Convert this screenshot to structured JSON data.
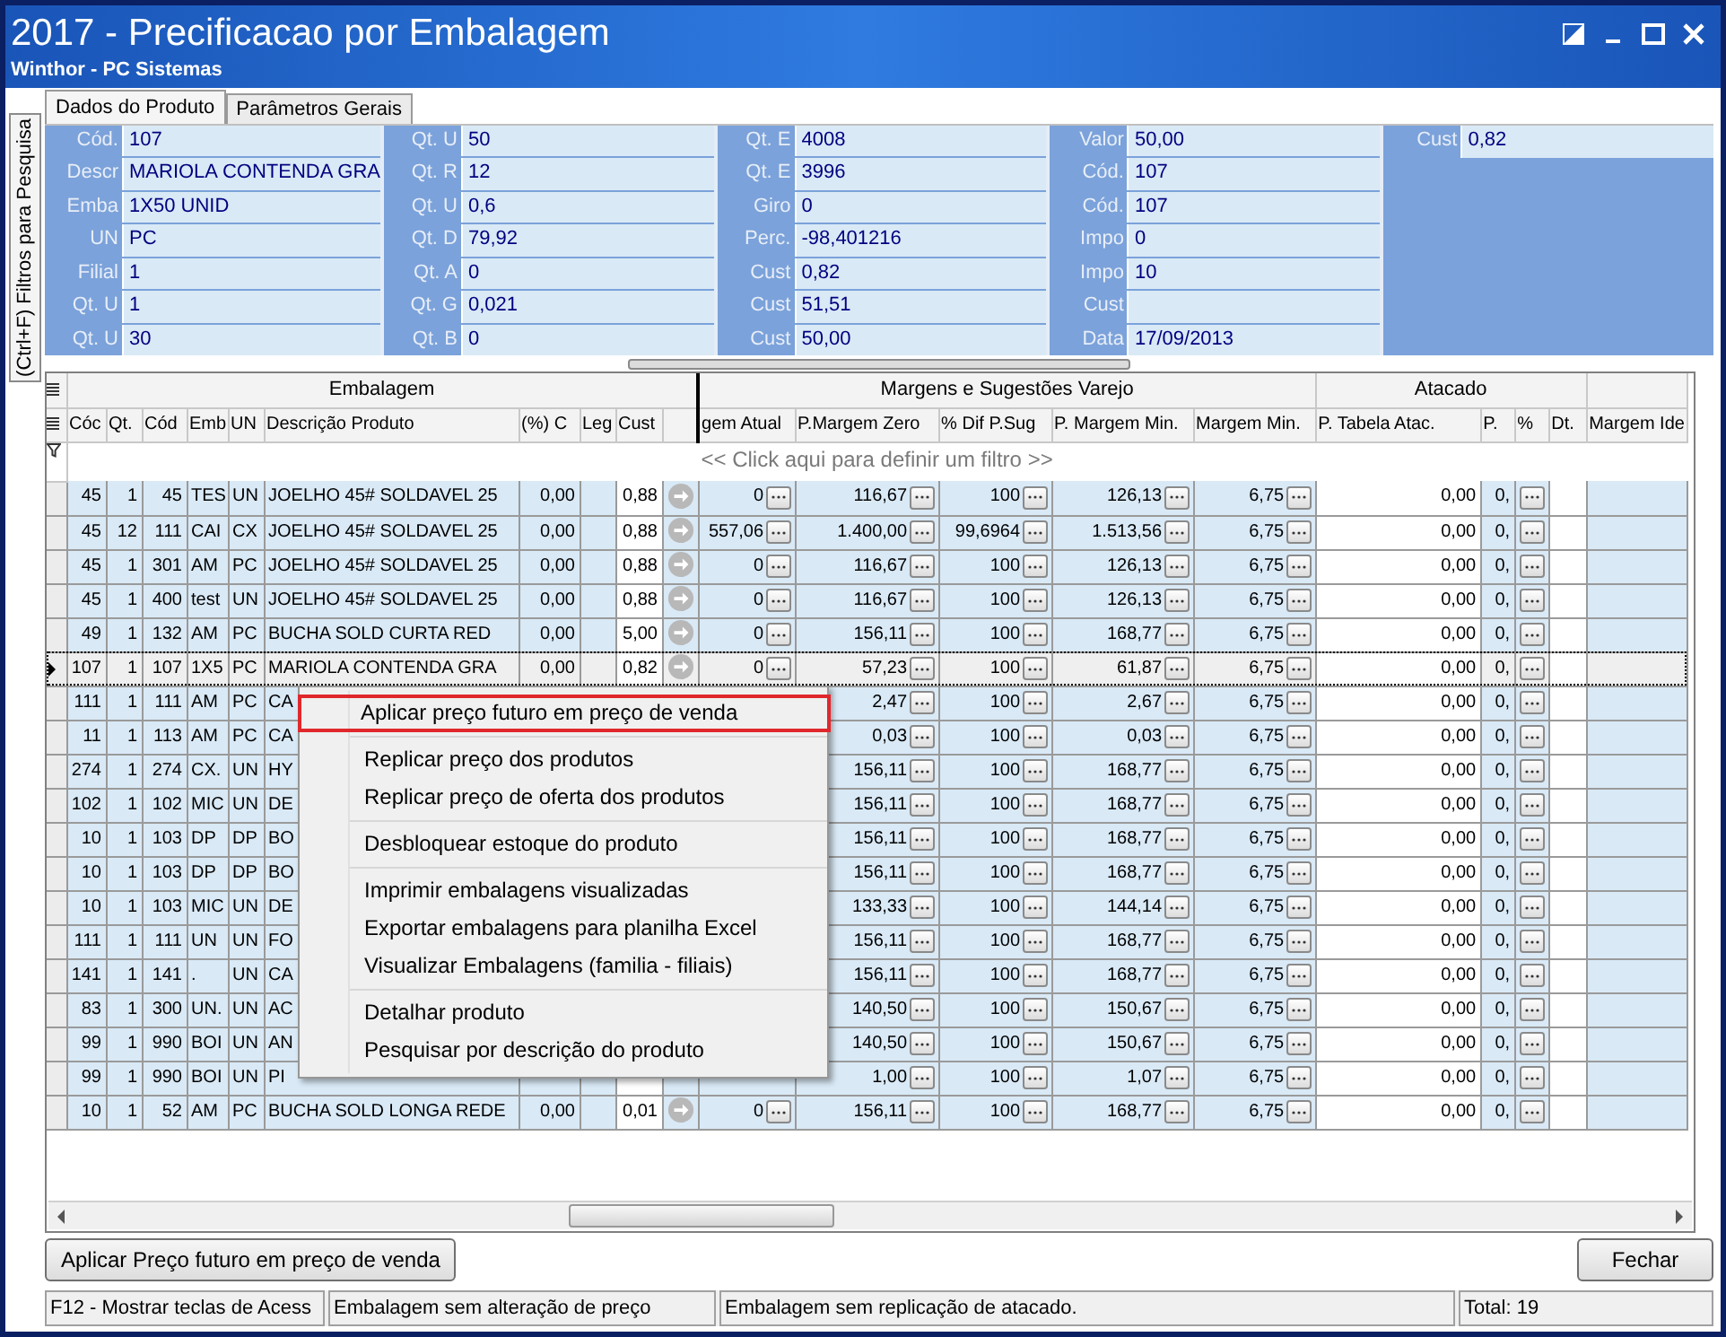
{
  "window": {
    "title": "2017 - Precificacao por Embalagem",
    "subtitle": "Winthor - PC Sistemas"
  },
  "side_tab": "(Ctrl+F) Filtros para Pesquisa",
  "tabs": [
    {
      "label": "Dados do Produto",
      "selected": true
    },
    {
      "label": "Parâmetros Gerais",
      "selected": false
    }
  ],
  "product_fields": [
    [
      {
        "label": "Cód.",
        "value": "107"
      },
      {
        "label": "Descr",
        "value": "MARIOLA CONTENDA GRA"
      },
      {
        "label": "Emba",
        "value": "1X50 UNID"
      },
      {
        "label": "UN",
        "value": "PC"
      },
      {
        "label": "Filial",
        "value": "1"
      },
      {
        "label": "Qt. U",
        "value": "1"
      },
      {
        "label": "Qt. U",
        "value": "30"
      }
    ],
    [
      {
        "label": "Qt. U",
        "value": "50"
      },
      {
        "label": "Qt. R",
        "value": "12"
      },
      {
        "label": "Qt. U",
        "value": "0,6"
      },
      {
        "label": "Qt. D",
        "value": "79,92"
      },
      {
        "label": "Qt. A",
        "value": "0"
      },
      {
        "label": "Qt. G",
        "value": "0,021"
      },
      {
        "label": "Qt. B",
        "value": "0"
      }
    ],
    [
      {
        "label": "Qt. E",
        "value": "4008"
      },
      {
        "label": "Qt. E",
        "value": "3996"
      },
      {
        "label": "Giro",
        "value": "0"
      },
      {
        "label": "Perc.",
        "value": "-98,401216"
      },
      {
        "label": "Cust",
        "value": "0,82"
      },
      {
        "label": "Cust",
        "value": "51,51"
      },
      {
        "label": "Cust",
        "value": "50,00"
      }
    ],
    [
      {
        "label": "Valor",
        "value": "50,00"
      },
      {
        "label": "Cód.",
        "value": "107"
      },
      {
        "label": "Cód.",
        "value": "107"
      },
      {
        "label": "Impo",
        "value": "0"
      },
      {
        "label": "Impo",
        "value": "10"
      },
      {
        "label": "Cust"
      },
      {
        "label": "Data",
        "value": "17/09/2013"
      }
    ],
    [
      {
        "label": "Cust",
        "value": "0,82"
      }
    ]
  ],
  "grid": {
    "groups": [
      {
        "label": "Embalagem",
        "columns": [
          {
            "label": "Cóc",
            "kind": "number"
          },
          {
            "label": "Qt.",
            "kind": "number"
          },
          {
            "label": "Cód",
            "kind": "number"
          },
          {
            "label": "Emb",
            "kind": "text"
          },
          {
            "label": "UN",
            "kind": "text"
          },
          {
            "label": "Descrição Produto",
            "kind": "text"
          },
          {
            "label": "(%) C",
            "kind": "number"
          },
          {
            "label": "Leg",
            "kind": "text"
          },
          {
            "label": "Cust",
            "kind": "editable"
          },
          {
            "kind": "action"
          }
        ]
      },
      {
        "label": "Margens e Sugestões Varejo",
        "columns": [
          {
            "label": "gem Atual",
            "kind": "picker"
          },
          {
            "label": "P.Margem Zero",
            "kind": "picker"
          },
          {
            "label": "% Dif P.Sug",
            "kind": "picker"
          },
          {
            "label": "P. Margem Min.",
            "kind": "picker"
          },
          {
            "label": "Margem Min.",
            "kind": "picker"
          }
        ]
      },
      {
        "label": "Atacado",
        "columns": [
          {
            "label": "P. Tabela Atac.",
            "kind": "editable"
          },
          {
            "label": "P.",
            "kind": "number"
          },
          {
            "label": "%",
            "kind": "button"
          },
          {
            "label": "Dt.",
            "kind": "editable"
          }
        ]
      },
      {
        "columns": [
          {
            "label": "Margem Ide",
            "kind": "text"
          }
        ]
      }
    ],
    "filter_hint": "<< Click aqui para definir um filtro >>",
    "rows": [
      {
        "selected": false,
        "cells": [
          "45",
          "1",
          "45",
          "TES",
          "UN",
          "JOELHO 45# SOLDAVEL  25",
          "0,00",
          null,
          "0,88",
          true,
          "0",
          "116,67",
          "100",
          "126,13",
          "6,75",
          "0,00",
          "0,",
          true,
          null,
          null
        ]
      },
      {
        "selected": false,
        "cells": [
          "45",
          "12",
          "111",
          "CAI",
          "CX",
          "JOELHO 45# SOLDAVEL  25",
          "0,00",
          null,
          "0,88",
          true,
          "557,06",
          "1.400,00",
          "99,6964",
          "1.513,56",
          "6,75",
          "0,00",
          "0,",
          true,
          null,
          null
        ]
      },
      {
        "selected": false,
        "cells": [
          "45",
          "1",
          "301",
          "AM",
          "PC",
          "JOELHO 45# SOLDAVEL  25",
          "0,00",
          null,
          "0,88",
          true,
          "0",
          "116,67",
          "100",
          "126,13",
          "6,75",
          "0,00",
          "0,",
          true,
          null,
          null
        ]
      },
      {
        "selected": false,
        "cells": [
          "45",
          "1",
          "400",
          "test",
          "UN",
          "JOELHO 45# SOLDAVEL  25",
          "0,00",
          null,
          "0,88",
          true,
          "0",
          "116,67",
          "100",
          "126,13",
          "6,75",
          "0,00",
          "0,",
          true,
          null,
          null
        ]
      },
      {
        "selected": false,
        "cells": [
          "49",
          "1",
          "132",
          "AM",
          "PC",
          "BUCHA SOLD CURTA RED",
          "0,00",
          null,
          "5,00",
          true,
          "0",
          "156,11",
          "100",
          "168,77",
          "6,75",
          "0,00",
          "0,",
          true,
          null,
          null
        ]
      },
      {
        "selected": true,
        "cells": [
          "107",
          "1",
          "107",
          "1X5",
          "PC",
          "MARIOLA CONTENDA GRA",
          "0,00",
          null,
          "0,82",
          true,
          "0",
          "57,23",
          "100",
          "61,87",
          "6,75",
          "0,00",
          "0,",
          true,
          null,
          null
        ]
      },
      {
        "selected": false,
        "cells": [
          "111",
          "1",
          "111",
          "AM",
          "PC",
          "CA",
          null,
          null,
          null,
          false,
          null,
          "2,47",
          "100",
          "2,67",
          "6,75",
          "0,00",
          "0,",
          true,
          null,
          null
        ]
      },
      {
        "selected": false,
        "cells": [
          "11",
          "1",
          "113",
          "AM",
          "PC",
          "CA",
          null,
          null,
          null,
          false,
          null,
          "0,03",
          "100",
          "0,03",
          "6,75",
          "0,00",
          "0,",
          true,
          null,
          null
        ]
      },
      {
        "selected": false,
        "cells": [
          "274",
          "1",
          "274",
          "CX.",
          "UN",
          "HY",
          null,
          null,
          null,
          false,
          null,
          "156,11",
          "100",
          "168,77",
          "6,75",
          "0,00",
          "0,",
          true,
          null,
          null
        ]
      },
      {
        "selected": false,
        "cells": [
          "102",
          "1",
          "102",
          "MIC",
          "UN",
          "DE",
          null,
          null,
          null,
          false,
          null,
          "156,11",
          "100",
          "168,77",
          "6,75",
          "0,00",
          "0,",
          true,
          null,
          null
        ]
      },
      {
        "selected": false,
        "cells": [
          "10",
          "1",
          "103",
          "DP",
          "DP",
          "BO",
          null,
          null,
          null,
          false,
          null,
          "156,11",
          "100",
          "168,77",
          "6,75",
          "0,00",
          "0,",
          true,
          null,
          null
        ]
      },
      {
        "selected": false,
        "cells": [
          "10",
          "1",
          "103",
          "DP",
          "DP",
          "BO",
          null,
          null,
          null,
          false,
          null,
          "156,11",
          "100",
          "168,77",
          "6,75",
          "0,00",
          "0,",
          true,
          null,
          null
        ]
      },
      {
        "selected": false,
        "cells": [
          "10",
          "1",
          "103",
          "MIC",
          "UN",
          "DE",
          null,
          null,
          null,
          false,
          null,
          "133,33",
          "100",
          "144,14",
          "6,75",
          "0,00",
          "0,",
          true,
          null,
          null
        ]
      },
      {
        "selected": false,
        "cells": [
          "111",
          "1",
          "111",
          "UN",
          "UN",
          "FO",
          null,
          null,
          null,
          false,
          null,
          "156,11",
          "100",
          "168,77",
          "6,75",
          "0,00",
          "0,",
          true,
          null,
          null
        ]
      },
      {
        "selected": false,
        "cells": [
          "141",
          "1",
          "141",
          ".",
          "UN",
          "CA",
          null,
          null,
          null,
          false,
          null,
          "156,11",
          "100",
          "168,77",
          "6,75",
          "0,00",
          "0,",
          true,
          null,
          null
        ]
      },
      {
        "selected": false,
        "cells": [
          "83",
          "1",
          "300",
          "UN.",
          "UN",
          "AC",
          null,
          null,
          null,
          false,
          null,
          "140,50",
          "100",
          "150,67",
          "6,75",
          "0,00",
          "0,",
          true,
          null,
          null
        ]
      },
      {
        "selected": false,
        "cells": [
          "99",
          "1",
          "990",
          "BOI",
          "UN",
          "AN",
          null,
          null,
          null,
          false,
          null,
          "140,50",
          "100",
          "150,67",
          "6,75",
          "0,00",
          "0,",
          true,
          null,
          null
        ]
      },
      {
        "selected": false,
        "cells": [
          "99",
          "1",
          "990",
          "BOI",
          "UN",
          "PI",
          null,
          null,
          null,
          false,
          null,
          "1,00",
          "100",
          "1,07",
          "6,75",
          "0,00",
          "0,",
          true,
          null,
          null
        ]
      },
      {
        "selected": false,
        "cells": [
          "10",
          "1",
          "52",
          "AM",
          "PC",
          "BUCHA SOLD LONGA REDE",
          "0,00",
          null,
          "0,01",
          true,
          "0",
          "156,11",
          "100",
          "168,77",
          "6,75",
          "0,00",
          "0,",
          true,
          null,
          null
        ]
      }
    ]
  },
  "context_menu": {
    "groups": [
      [
        {
          "label": "Aplicar preço futuro em preço de venda",
          "selected": true
        }
      ],
      [
        {
          "label": "Replicar preço dos produtos",
          "selected": false
        },
        {
          "label": "Replicar preço de oferta dos produtos",
          "selected": false
        }
      ],
      [
        {
          "label": "Desbloquear estoque do produto",
          "selected": false
        }
      ],
      [
        {
          "label": "Imprimir embalagens visualizadas",
          "selected": false
        },
        {
          "label": "Exportar embalagens para planilha Excel",
          "selected": false
        },
        {
          "label": "Visualizar Embalagens (familia - filiais)",
          "selected": false
        }
      ],
      [
        {
          "label": "Detalhar produto",
          "selected": false
        },
        {
          "label": "Pesquisar por descrição do produto",
          "selected": false
        }
      ]
    ]
  },
  "buttons": {
    "apply": "Aplicar Preço futuro em preço de venda",
    "close": "Fechar"
  },
  "status_bar": [
    "F12 - Mostrar teclas de Acess",
    "Embalagem sem alteração de preço",
    "Embalagem sem replicação de atacado.",
    "Total: 19"
  ]
}
